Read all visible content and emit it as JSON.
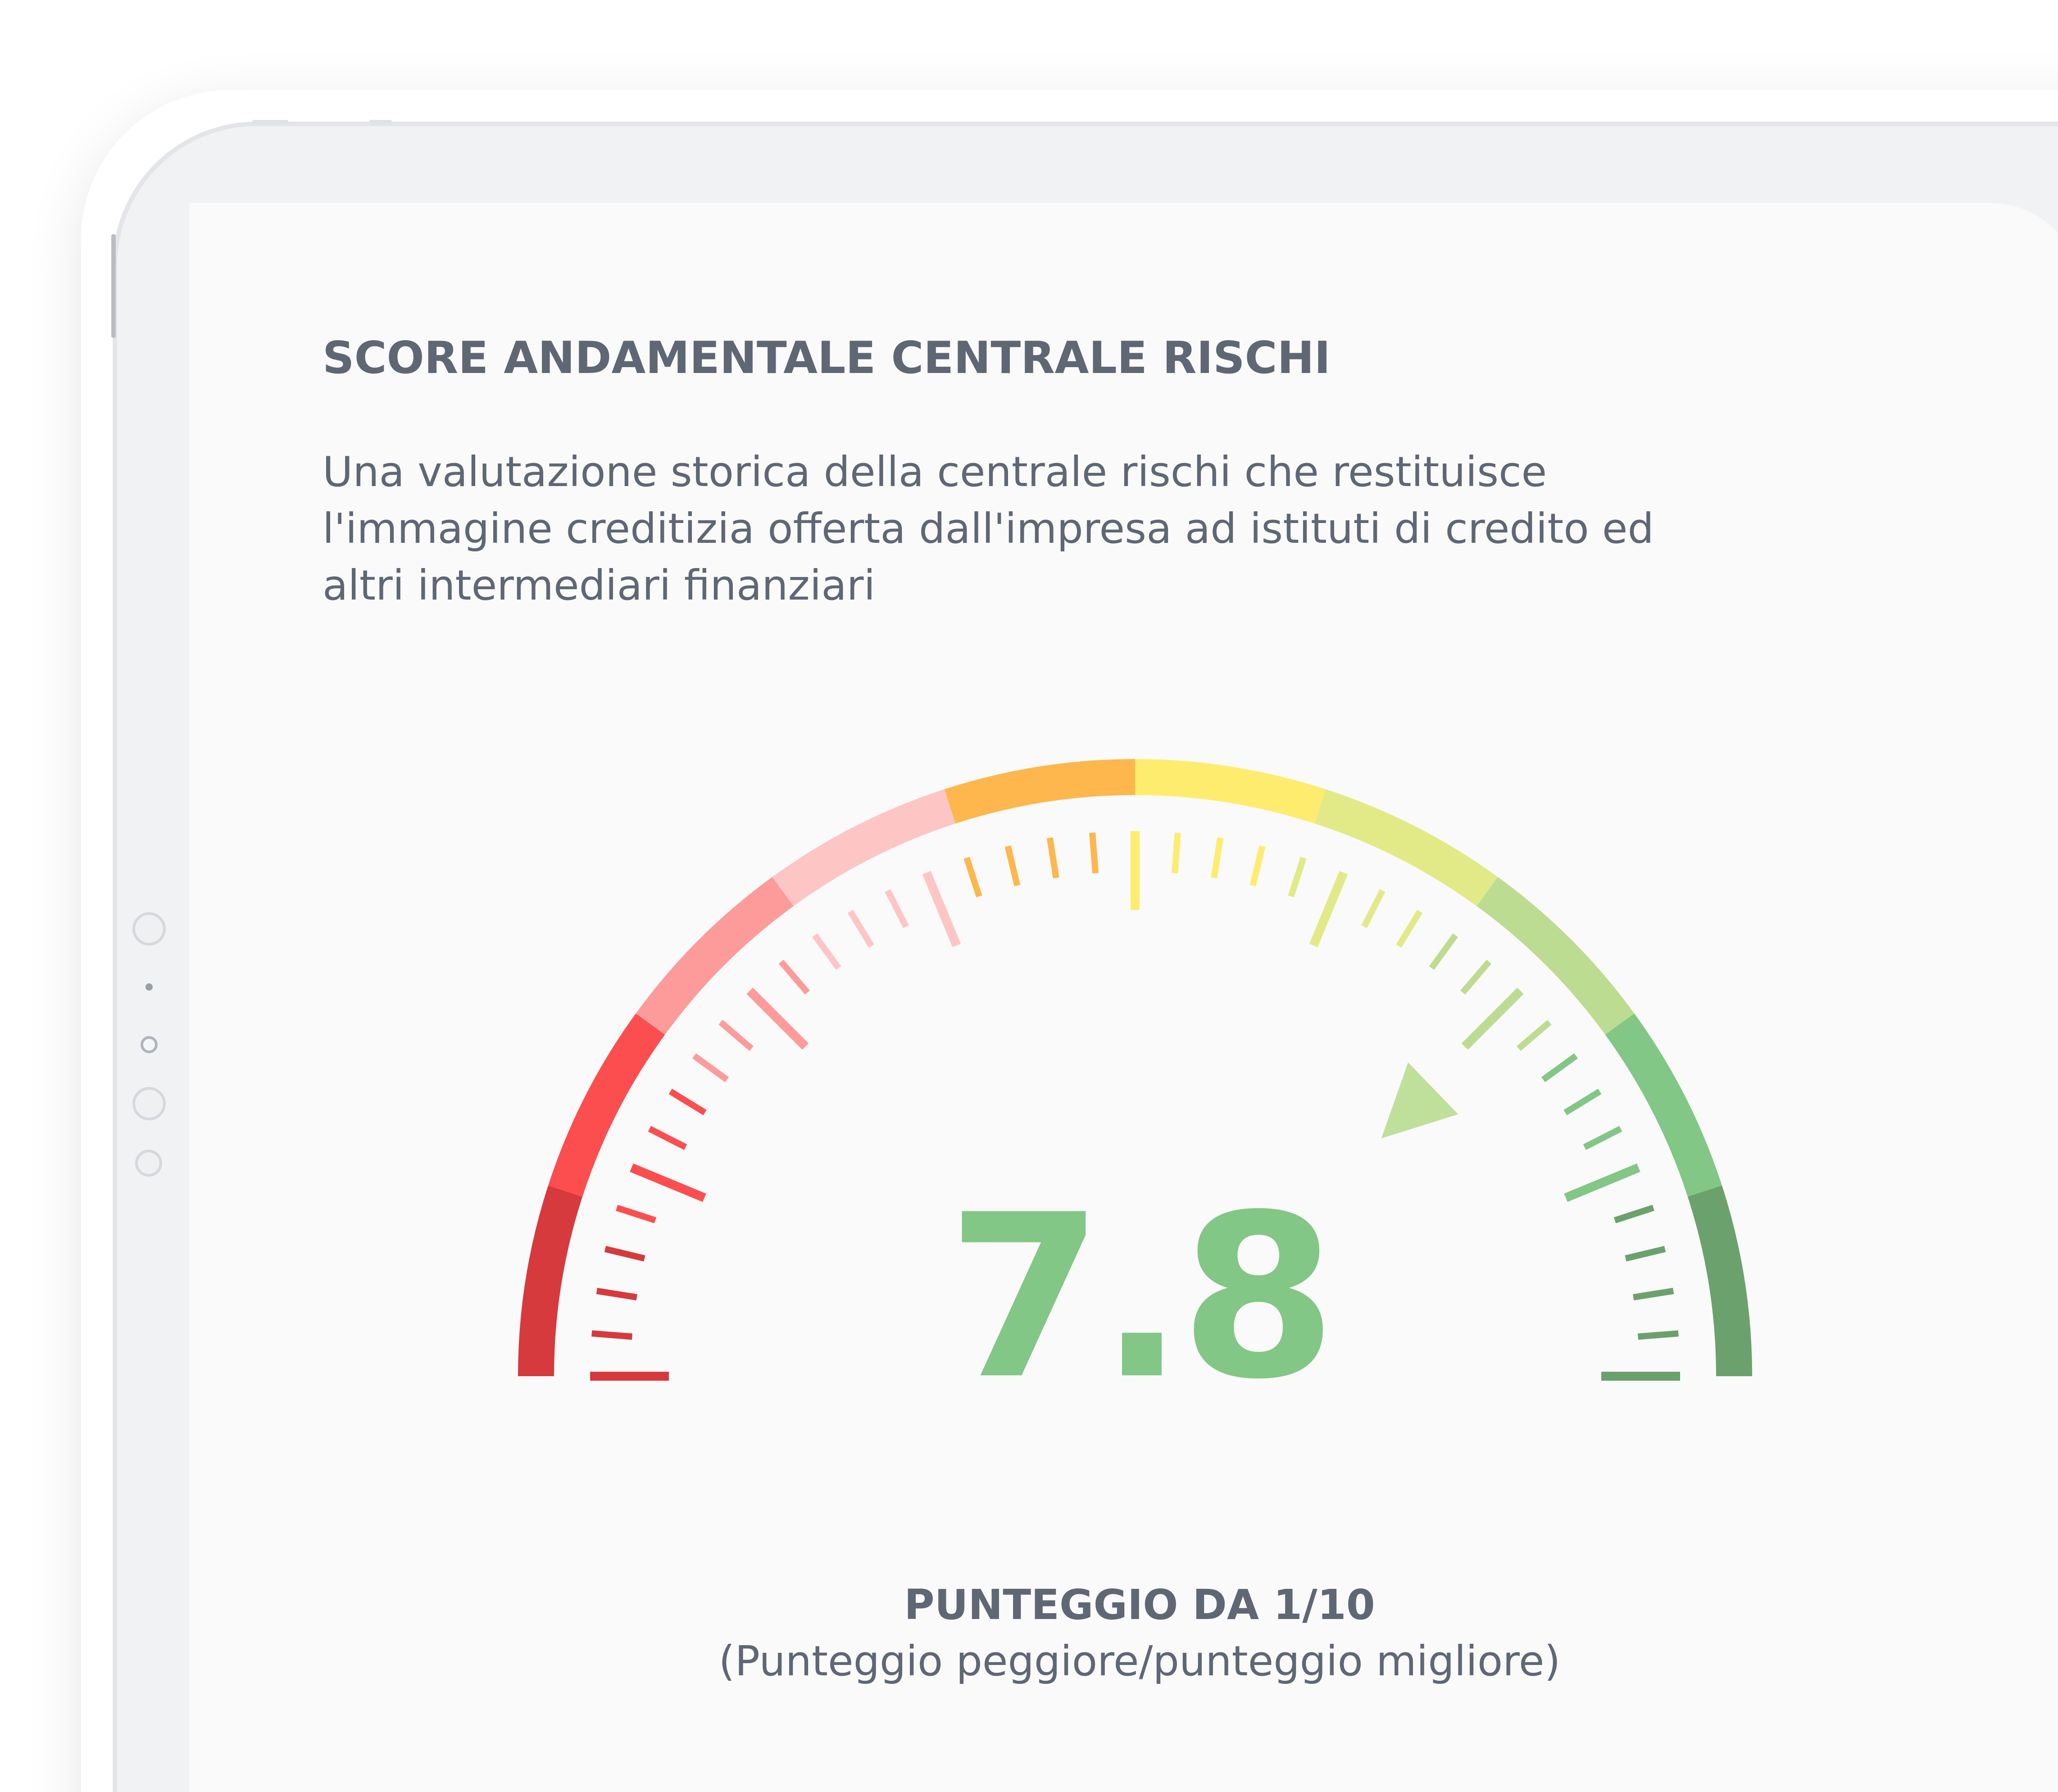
{
  "card": {
    "title": "SCORE ANDAMENTALE CENTRALE RISCHI",
    "description": "Una valutazione storica della centrale rischi che restituisce l'immagine creditizia offerta dall'impresa ad istituti di credito ed altri intermediari finanziari"
  },
  "gauge": {
    "score": 7.8,
    "score_label": "7.8",
    "min": 1,
    "max": 10,
    "scale_title": "PUNTEGGIO DA 1/10",
    "scale_subtitle": "(Punteggio peggiore/punteggio migliore)",
    "segment_colors": [
      "#d63a3c",
      "#fc4e4f",
      "#fd9b9b",
      "#fec5c5",
      "#fdb74d",
      "#feec6f",
      "#e2ea88",
      "#bcdd91",
      "#82c785",
      "#6ba16d"
    ],
    "pointer_color": "#bfe09a",
    "score_color": "#82c785"
  },
  "device": {
    "frame_color": "#f1f2f4",
    "screen_color": "#fafafa"
  }
}
